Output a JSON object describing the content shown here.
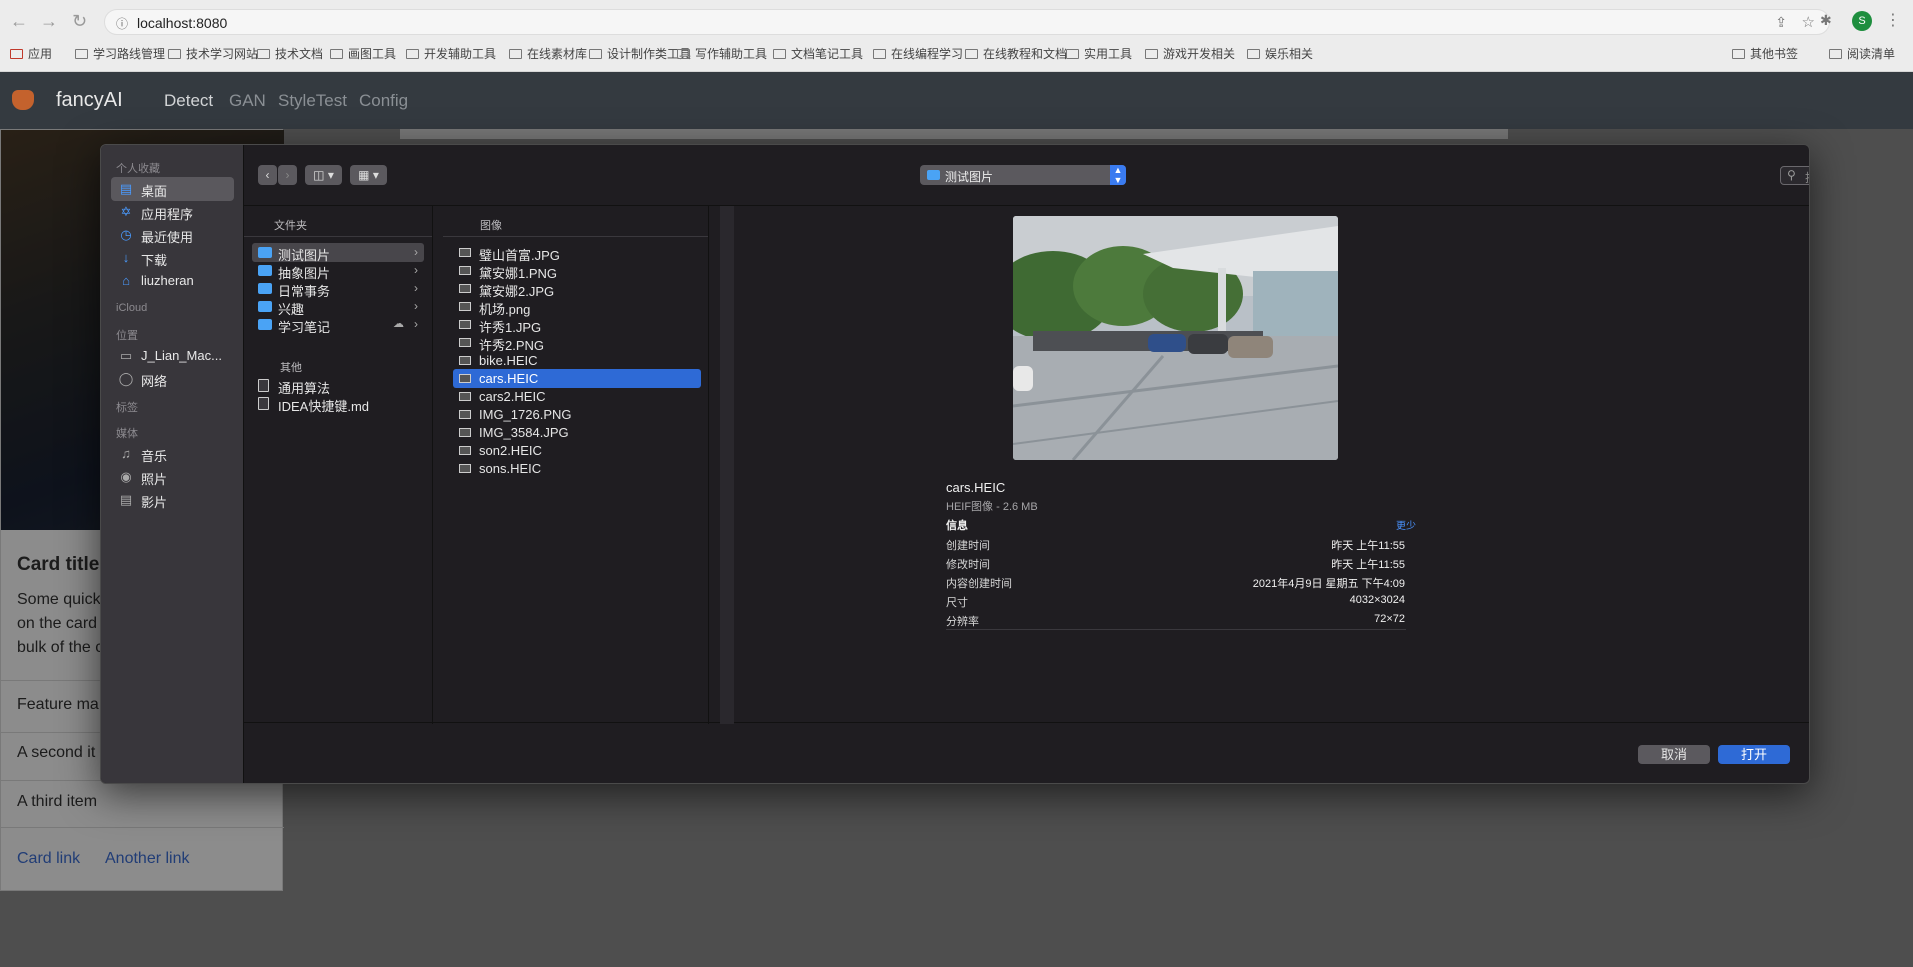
{
  "browser": {
    "url": "localhost:8080",
    "bookmarks": [
      "应用",
      "学习路线管理",
      "技术学习网站",
      "技术文档",
      "画图工具",
      "开发辅助工具",
      "在线素材库",
      "设计制作类工具",
      "写作辅助工具",
      "文档笔记工具",
      "在线编程学习",
      "在线教程和文档",
      "实用工具",
      "游戏开发相关",
      "娱乐相关"
    ],
    "bookmarks_right": [
      "其他书签",
      "阅读清单"
    ],
    "profile_initial": "S"
  },
  "app": {
    "brand": "fancyAI",
    "nav": [
      "Detect",
      "GAN",
      "StyleTest",
      "Config"
    ]
  },
  "card": {
    "title": "Card title",
    "text_lines": [
      "Some quick",
      "on the card",
      "bulk of the c"
    ],
    "items": [
      "Feature ma",
      "A second it",
      "A third item"
    ],
    "links": [
      "Card link",
      "Another link"
    ]
  },
  "dialog": {
    "sidebar": {
      "favorites_header": "个人收藏",
      "favorites": [
        "桌面",
        "应用程序",
        "最近使用",
        "下载",
        "liuzheran"
      ],
      "icloud_header": "iCloud",
      "locations_header": "位置",
      "locations": [
        "J_Lian_Mac...",
        "网络"
      ],
      "tags_header": "标签",
      "media_header": "媒体",
      "media": [
        "音乐",
        "照片",
        "影片"
      ]
    },
    "path": "测试图片",
    "search_placeholder": "搜索",
    "col1": {
      "header": "文件夹",
      "folders": [
        "测试图片",
        "抽象图片",
        "日常事务",
        "兴趣",
        "学习笔记"
      ],
      "other_header": "其他",
      "files": [
        "通用算法",
        "IDEA快捷键.md"
      ]
    },
    "col2": {
      "header": "图像",
      "files": [
        "璧山首富.JPG",
        "黛安娜1.PNG",
        "黛安娜2.JPG",
        "机场.png",
        "许秀1.JPG",
        "许秀2.PNG",
        "bike.HEIC",
        "cars.HEIC",
        "cars2.HEIC",
        "IMG_1726.PNG",
        "IMG_3584.JPG",
        "son2.HEIC",
        "sons.HEIC"
      ],
      "selected": "cars.HEIC"
    },
    "preview": {
      "name": "cars.HEIC",
      "kind": "HEIF图像 - 2.6 MB",
      "info_title": "信息",
      "less": "更少",
      "rows": [
        {
          "k": "创建时间",
          "v": "昨天 上午11:55"
        },
        {
          "k": "修改时间",
          "v": "昨天 上午11:55"
        },
        {
          "k": "内容创建时间",
          "v": "2021年4月9日 星期五 下午4:09"
        },
        {
          "k": "尺寸",
          "v": "4032×3024"
        },
        {
          "k": "分辨率",
          "v": "72×72"
        }
      ]
    },
    "cancel": "取消",
    "open": "打开"
  }
}
